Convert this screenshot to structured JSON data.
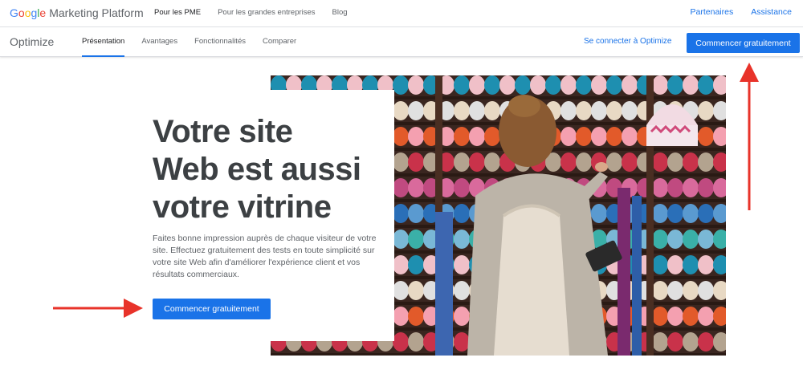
{
  "header": {
    "logo": {
      "letters": [
        "G",
        "o",
        "o",
        "g",
        "l",
        "e"
      ],
      "letter_colors": [
        "#4285F4",
        "#EA4335",
        "#FBBC05",
        "#4285F4",
        "#34A853",
        "#EA4335"
      ],
      "product": "Marketing Platform"
    },
    "nav": [
      "Pour les PME",
      "Pour les grandes entreprises",
      "Blog"
    ],
    "nav_active_index": 0,
    "right_links": [
      "Partenaires",
      "Assistance"
    ]
  },
  "product_bar": {
    "name": "Optimize",
    "tabs": [
      "Présentation",
      "Avantages",
      "Fonctionnalités",
      "Comparer"
    ],
    "active_tab_index": 0,
    "signin_label": "Se connecter à Optimize",
    "cta_label": "Commencer gratuitement"
  },
  "hero": {
    "headline_lines": [
      "Votre site",
      "Web est aussi",
      "votre vitrine"
    ],
    "description": "Faites bonne impression auprès de chaque visiteur de votre site. Effectuez gratuitement des tests en toute simplicité sur votre site Web afin d'améliorer l'expérience client et vos résultats commerciaux.",
    "cta_label": "Commencer gratuitement",
    "image_icon": "yarn-shop-photo"
  },
  "annotations": {
    "arrow_color": "#e8332a"
  },
  "colors": {
    "accent": "#1a73e8",
    "text": "#3c4043",
    "muted": "#5f6368"
  }
}
